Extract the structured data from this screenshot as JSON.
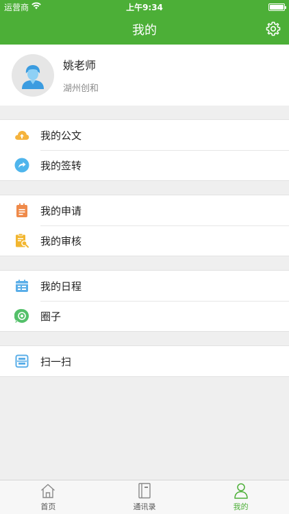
{
  "status": {
    "carrier": "运营商",
    "time": "上午9:34"
  },
  "nav": {
    "title": "我的"
  },
  "profile": {
    "name": "姚老师",
    "org": "湖州创和"
  },
  "groups": [
    {
      "items": [
        {
          "icon": "cloud-upload-icon",
          "label": "我的公文",
          "color": "#f5b33d"
        },
        {
          "icon": "share-arrow-icon",
          "label": "我的签转",
          "color": "#4fb5ec"
        }
      ]
    },
    {
      "items": [
        {
          "icon": "clipboard-icon",
          "label": "我的申请",
          "color": "#ef8a4a"
        },
        {
          "icon": "review-doc-icon",
          "label": "我的审核",
          "color": "#f2b630"
        }
      ]
    },
    {
      "items": [
        {
          "icon": "calendar-icon",
          "label": "我的日程",
          "color": "#5aaee8"
        },
        {
          "icon": "circle-chat-icon",
          "label": "圈子",
          "color": "#54c06a"
        }
      ]
    },
    {
      "items": [
        {
          "icon": "scan-icon",
          "label": "扫一扫",
          "color": "#5aaee8"
        }
      ]
    }
  ],
  "tabs": [
    {
      "label": "首页",
      "icon": "home-icon",
      "active": false
    },
    {
      "label": "通讯录",
      "icon": "contacts-book-icon",
      "active": false
    },
    {
      "label": "我的",
      "icon": "person-icon",
      "active": true
    }
  ],
  "colors": {
    "brand": "#4caf37",
    "background": "#efefef"
  }
}
